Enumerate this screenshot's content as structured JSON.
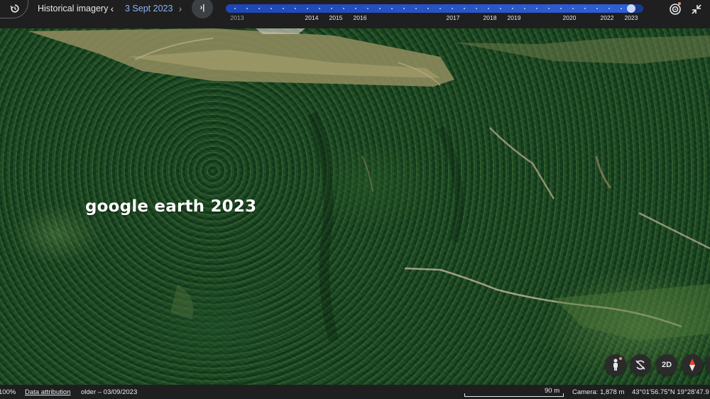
{
  "header": {
    "history_icon": "history-icon",
    "title": "Historical imagery",
    "prev_glyph": "‹",
    "date": "3 Sept 2023",
    "next_glyph": "›",
    "jump_glyph": "›|"
  },
  "timeline": {
    "years": [
      "2013",
      "2014",
      "2015",
      "2016",
      "2017",
      "2018",
      "2019",
      "2020",
      "2022",
      "2023"
    ],
    "dim_years": [
      "2013"
    ],
    "selected_year": "2023",
    "progress": 0.97
  },
  "map": {
    "watermark_text": "google earth 2023"
  },
  "controls": {
    "pegman_icon": "pegman-icon",
    "reset_tilt_icon": "reset-tilt-icon",
    "view_2d_label": "2D",
    "compass_icon": "compass-icon"
  },
  "status": {
    "zoom": "100%",
    "attribution": "Data attribution",
    "imagery_date": "older – 03/09/2023",
    "scale": "90 m",
    "camera": "Camera: 1,878 m",
    "coordinates": "43°01'56.75\"N 19°28'47.9"
  },
  "colors": {
    "accent": "#8ab4f8",
    "timeline_track": "#1a3a8f",
    "timeline_handle": "#c7d7fb",
    "bar_bg": "#1f1f1f",
    "notification": "#f28b82"
  }
}
